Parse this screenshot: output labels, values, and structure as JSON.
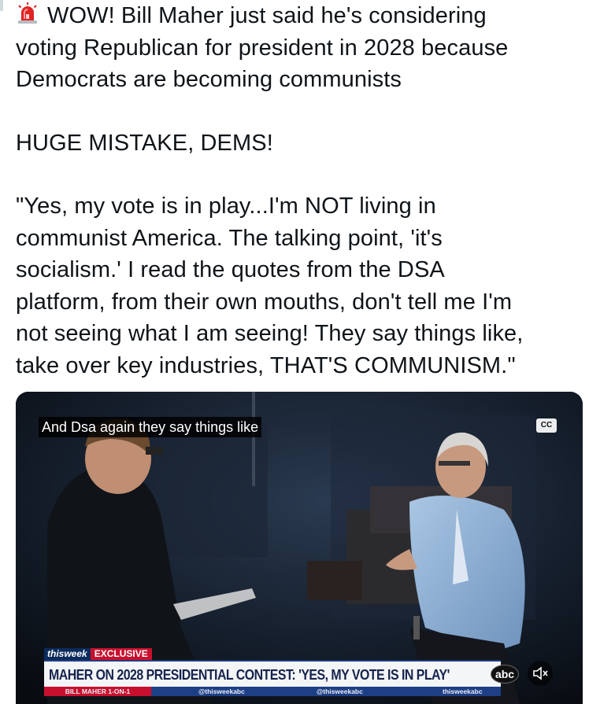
{
  "tweet": {
    "lines": [
      "WOW! Bill Maher just said he's considering",
      "voting Republican for president in 2028 because",
      "Democrats are becoming communists",
      "HUGE MISTAKE, DEMS!",
      "\"Yes, my vote is in play...I'm NOT living in",
      "communist America. The talking point, 'it's",
      "socialism.' I read the quotes from the DSA",
      "platform, from their own mouths, don't tell me I'm",
      "not seeing what I am seeing! They say things like,",
      "take over key industries, THAT'S COMMUNISM.\""
    ],
    "emoji_icon": "police-siren-icon"
  },
  "video": {
    "caption": "And Dsa again they say things like",
    "cc_label": "CC",
    "lower_third": {
      "show_logo": "thisweek",
      "tag": "EXCLUSIVE",
      "headline": "MAHER ON 2028 PRESIDENTIAL CONTEST: 'YES, MY VOTE IS IN PLAY'",
      "network": "abc",
      "segment": "BILL MAHER 1-ON-1",
      "handles": [
        "@thisweekabc",
        "@thisweekabc",
        "thisweekabc"
      ]
    },
    "mute_icon": "speaker-muted-icon"
  },
  "colors": {
    "text": "#0f1419",
    "abc_blue": "#1d3f86",
    "abc_red": "#c8102e"
  }
}
